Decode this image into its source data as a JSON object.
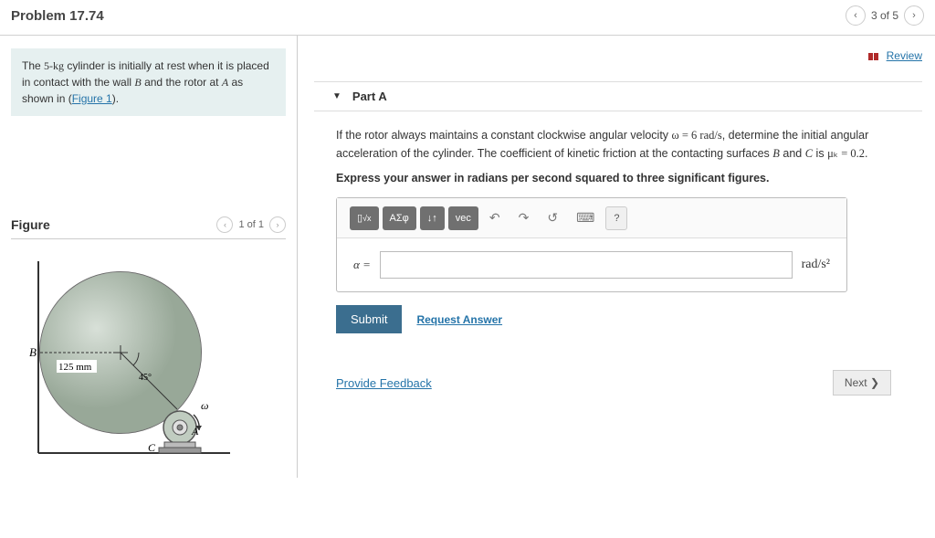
{
  "header": {
    "title": "Problem 17.74",
    "pager_text": "3 of 5"
  },
  "review_label": "Review",
  "problem": {
    "mass": "5-kg",
    "text1": "The ",
    "text2": " cylinder is initially at rest when it is placed in contact with the wall ",
    "B": "B",
    "text3": " and the rotor at ",
    "A": "A",
    "text4": " as shown in (",
    "figlink": "Figure 1",
    "text5": ")."
  },
  "figure": {
    "label": "Figure",
    "pager": "1 of 1",
    "radius_label": "125 mm",
    "angle_label": "45°",
    "B_label": "B",
    "A_label": "A",
    "C_label": "C",
    "omega_label": "ω"
  },
  "part": {
    "label": "Part A",
    "q1": "If the rotor always maintains a constant clockwise angular velocity ",
    "omega_eq": "ω = 6 rad/s",
    "q2": ", determine the initial angular acceleration of the cylinder. The coefficient of kinetic friction at the contacting surfaces ",
    "q3": " and ",
    "q4": " is ",
    "mu_eq": "μₖ = 0.2",
    "instruct": "Express your answer in radians per second squared to three significant figures.",
    "alpha": "α =",
    "unit": "rad/s²",
    "submit": "Submit",
    "request": "Request Answer"
  },
  "toolbar": {
    "t1": "√x",
    "t2": "ΑΣφ",
    "t3": "↓↑",
    "t4": "vec",
    "undo": "↶",
    "redo": "↷",
    "reset": "↺",
    "kbd": "⌨",
    "help": "?"
  },
  "feedback": "Provide Feedback",
  "next": "Next"
}
